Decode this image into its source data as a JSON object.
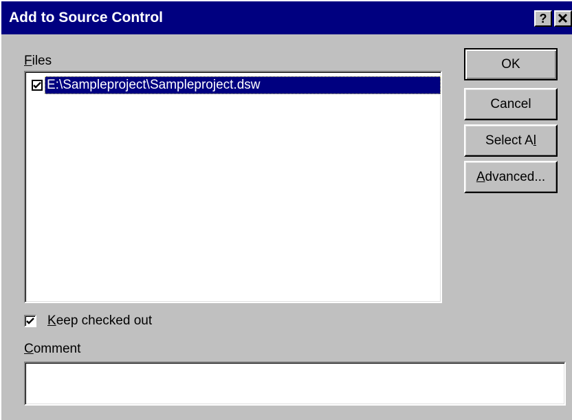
{
  "window": {
    "title": "Add to Source Control",
    "help_button": "?",
    "close_button": "✕"
  },
  "files": {
    "label_mnemonic": "F",
    "label_rest": "iles",
    "items": [
      {
        "path": "E:\\Sampleproject\\Sampleproject.dsw",
        "checked": true,
        "selected": true
      }
    ]
  },
  "buttons": {
    "ok": "OK",
    "cancel": "Cancel",
    "select_all_pre": "Select A",
    "select_all_mnemonic": "l",
    "select_all_post": "l",
    "advanced_mnemonic": "A",
    "advanced_rest": "dvanced..."
  },
  "keep_checked_out": {
    "mnemonic": "K",
    "rest": "eep checked out",
    "checked": true
  },
  "comment": {
    "label_mnemonic": "C",
    "label_rest": "omment",
    "value": ""
  },
  "colors": {
    "titlebar": "#000080",
    "face": "#c0c0c0",
    "selection": "#000080"
  }
}
